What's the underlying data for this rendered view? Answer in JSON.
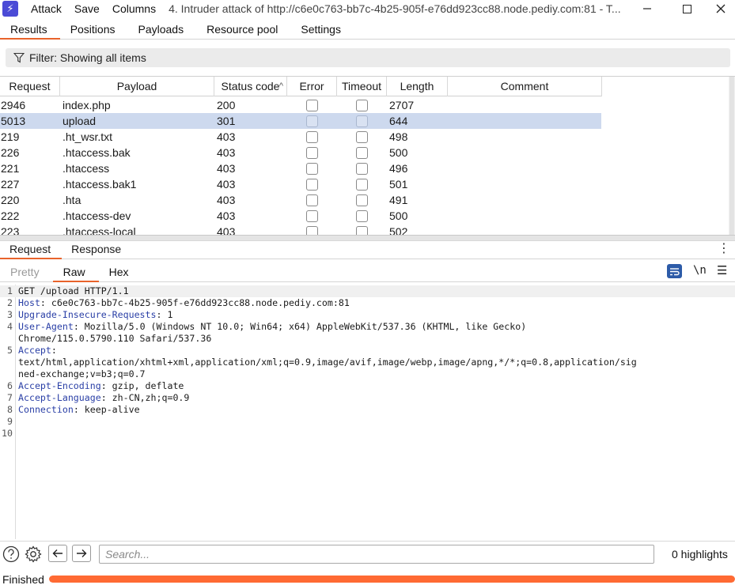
{
  "titlebar": {
    "menu": [
      "Attack",
      "Save",
      "Columns"
    ],
    "title": "4. Intruder attack of http://c6e0c763-bb7c-4b25-905f-e76dd923cc88.node.pediy.com:81 - T..."
  },
  "tabs": [
    {
      "label": "Results",
      "active": true
    },
    {
      "label": "Positions",
      "active": false
    },
    {
      "label": "Payloads",
      "active": false
    },
    {
      "label": "Resource pool",
      "active": false
    },
    {
      "label": "Settings",
      "active": false
    }
  ],
  "filter": {
    "label": "Filter: Showing all items"
  },
  "table": {
    "columns": [
      "Request",
      "Payload",
      "Status code",
      "Error",
      "Timeout",
      "Length",
      "Comment"
    ],
    "sort_column": "Status code",
    "rows": [
      {
        "request": "2946",
        "payload": "index.php",
        "status": "200",
        "length": "2707",
        "selected": false
      },
      {
        "request": "5013",
        "payload": "upload",
        "status": "301",
        "length": "644",
        "selected": true
      },
      {
        "request": "219",
        "payload": ".ht_wsr.txt",
        "status": "403",
        "length": "498",
        "selected": false
      },
      {
        "request": "226",
        "payload": ".htaccess.bak",
        "status": "403",
        "length": "500",
        "selected": false
      },
      {
        "request": "221",
        "payload": ".htaccess",
        "status": "403",
        "length": "496",
        "selected": false
      },
      {
        "request": "227",
        "payload": ".htaccess.bak1",
        "status": "403",
        "length": "501",
        "selected": false
      },
      {
        "request": "220",
        "payload": ".hta",
        "status": "403",
        "length": "491",
        "selected": false
      },
      {
        "request": "222",
        "payload": ".htaccess-dev",
        "status": "403",
        "length": "500",
        "selected": false
      },
      {
        "request": "223",
        "payload": ".htaccess-local",
        "status": "403",
        "length": "502",
        "selected": false
      }
    ]
  },
  "rr_tabs": [
    {
      "label": "Request",
      "active": true
    },
    {
      "label": "Response",
      "active": false
    }
  ],
  "view_tabs": [
    {
      "label": "Pretty",
      "state": "inactive"
    },
    {
      "label": "Raw",
      "state": "active"
    },
    {
      "label": "Hex",
      "state": "normal"
    }
  ],
  "toolbar": {
    "newline_label": "\\n"
  },
  "editor": {
    "lines": [
      {
        "n": "1",
        "key": "",
        "rest": "GET /upload HTTP/1.1"
      },
      {
        "n": "2",
        "key": "Host",
        "rest": ": c6e0c763-bb7c-4b25-905f-e76dd923cc88.node.pediy.com:81"
      },
      {
        "n": "3",
        "key": "Upgrade-Insecure-Requests",
        "rest": ": 1"
      },
      {
        "n": "4",
        "key": "User-Agent",
        "rest": ": Mozilla/5.0 (Windows NT 10.0; Win64; x64) AppleWebKit/537.36 (KHTML, like Gecko)"
      },
      {
        "n": "",
        "key": "",
        "rest": "Chrome/115.0.5790.110 Safari/537.36"
      },
      {
        "n": "5",
        "key": "Accept",
        "rest": ":"
      },
      {
        "n": "",
        "key": "",
        "rest": "text/html,application/xhtml+xml,application/xml;q=0.9,image/avif,image/webp,image/apng,*/*;q=0.8,application/sig"
      },
      {
        "n": "",
        "key": "",
        "rest": "ned-exchange;v=b3;q=0.7"
      },
      {
        "n": "6",
        "key": "Accept-Encoding",
        "rest": ": gzip, deflate"
      },
      {
        "n": "7",
        "key": "Accept-Language",
        "rest": ": zh-CN,zh;q=0.9"
      },
      {
        "n": "8",
        "key": "Connection",
        "rest": ": keep-alive"
      },
      {
        "n": "9",
        "key": "",
        "rest": ""
      },
      {
        "n": "10",
        "key": "",
        "rest": ""
      }
    ]
  },
  "bottom": {
    "search_placeholder": "Search...",
    "highlights": "0 highlights"
  },
  "status": {
    "text": "Finished",
    "progress": 1.0
  },
  "colors": {
    "accent": "#e8632b",
    "progress": "#ff6a33",
    "header_key": "#2a3fa6",
    "selected_row": "#cdd9ee"
  }
}
